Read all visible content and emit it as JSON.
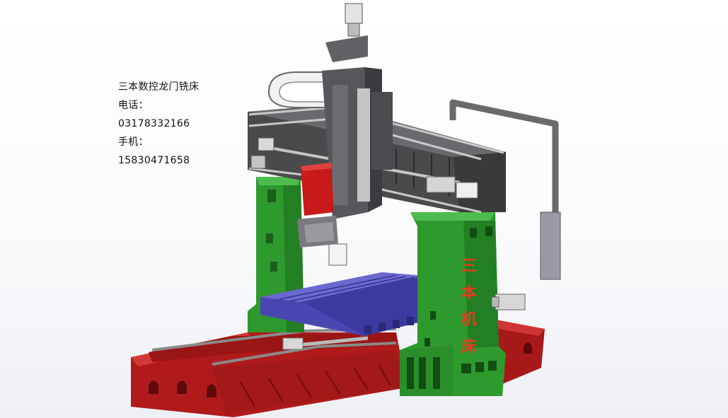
{
  "contact": {
    "company": "三本数控龙门铣床",
    "phone_label": "电话：",
    "phone": "03178332166",
    "mobile_label": "手机：",
    "mobile": "15830471658"
  },
  "column_label": {
    "chars": [
      "三",
      "本",
      "机",
      "床"
    ]
  },
  "colors": {
    "base_red": "#b81d1d",
    "column_green": "#2e9a2e",
    "table_blue": "#4a48b0",
    "gantry_gray": "#4a4a4c",
    "spindle_red": "#c81a1a",
    "label_red": "#e53c1e"
  }
}
